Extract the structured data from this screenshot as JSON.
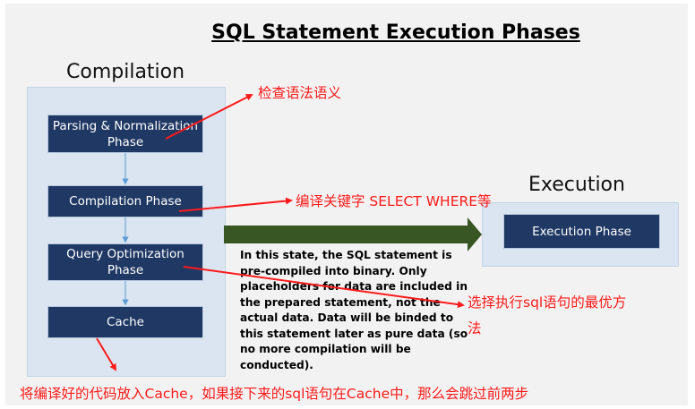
{
  "title": "SQL Statement Execution Phases",
  "compilation_label": "Compilation",
  "execution_label": "Execution",
  "boxes": {
    "parsing": "Parsing & Normalization Phase",
    "compilation": "Compilation Phase",
    "optimization": "Query  Optimization Phase",
    "cache": "Cache",
    "execution": "Execution Phase"
  },
  "note": "In this state, the SQL statement is pre-compiled into binary. Only placeholders for data are included in the prepared statement, not the actual data. Data will be binded to this statement later as pure data (so no more compilation will be conducted).",
  "annotations": {
    "parsing": "检查语法语义",
    "compilation": "编译关键字 SELECT WHERE等",
    "optimization_line1": "选择执行sql语句的最优方",
    "optimization_line2": "法",
    "cache": "将编译好的代码放入Cache，如果接下来的sql语句在Cache中，那么会跳过前两步"
  },
  "colors": {
    "box_fill": "#1f3864",
    "panel_fill": "#dae5f1",
    "arrow_green": "#375623",
    "annotation_red": "#ff1a1a",
    "connector_blue": "#5b9bd5"
  }
}
